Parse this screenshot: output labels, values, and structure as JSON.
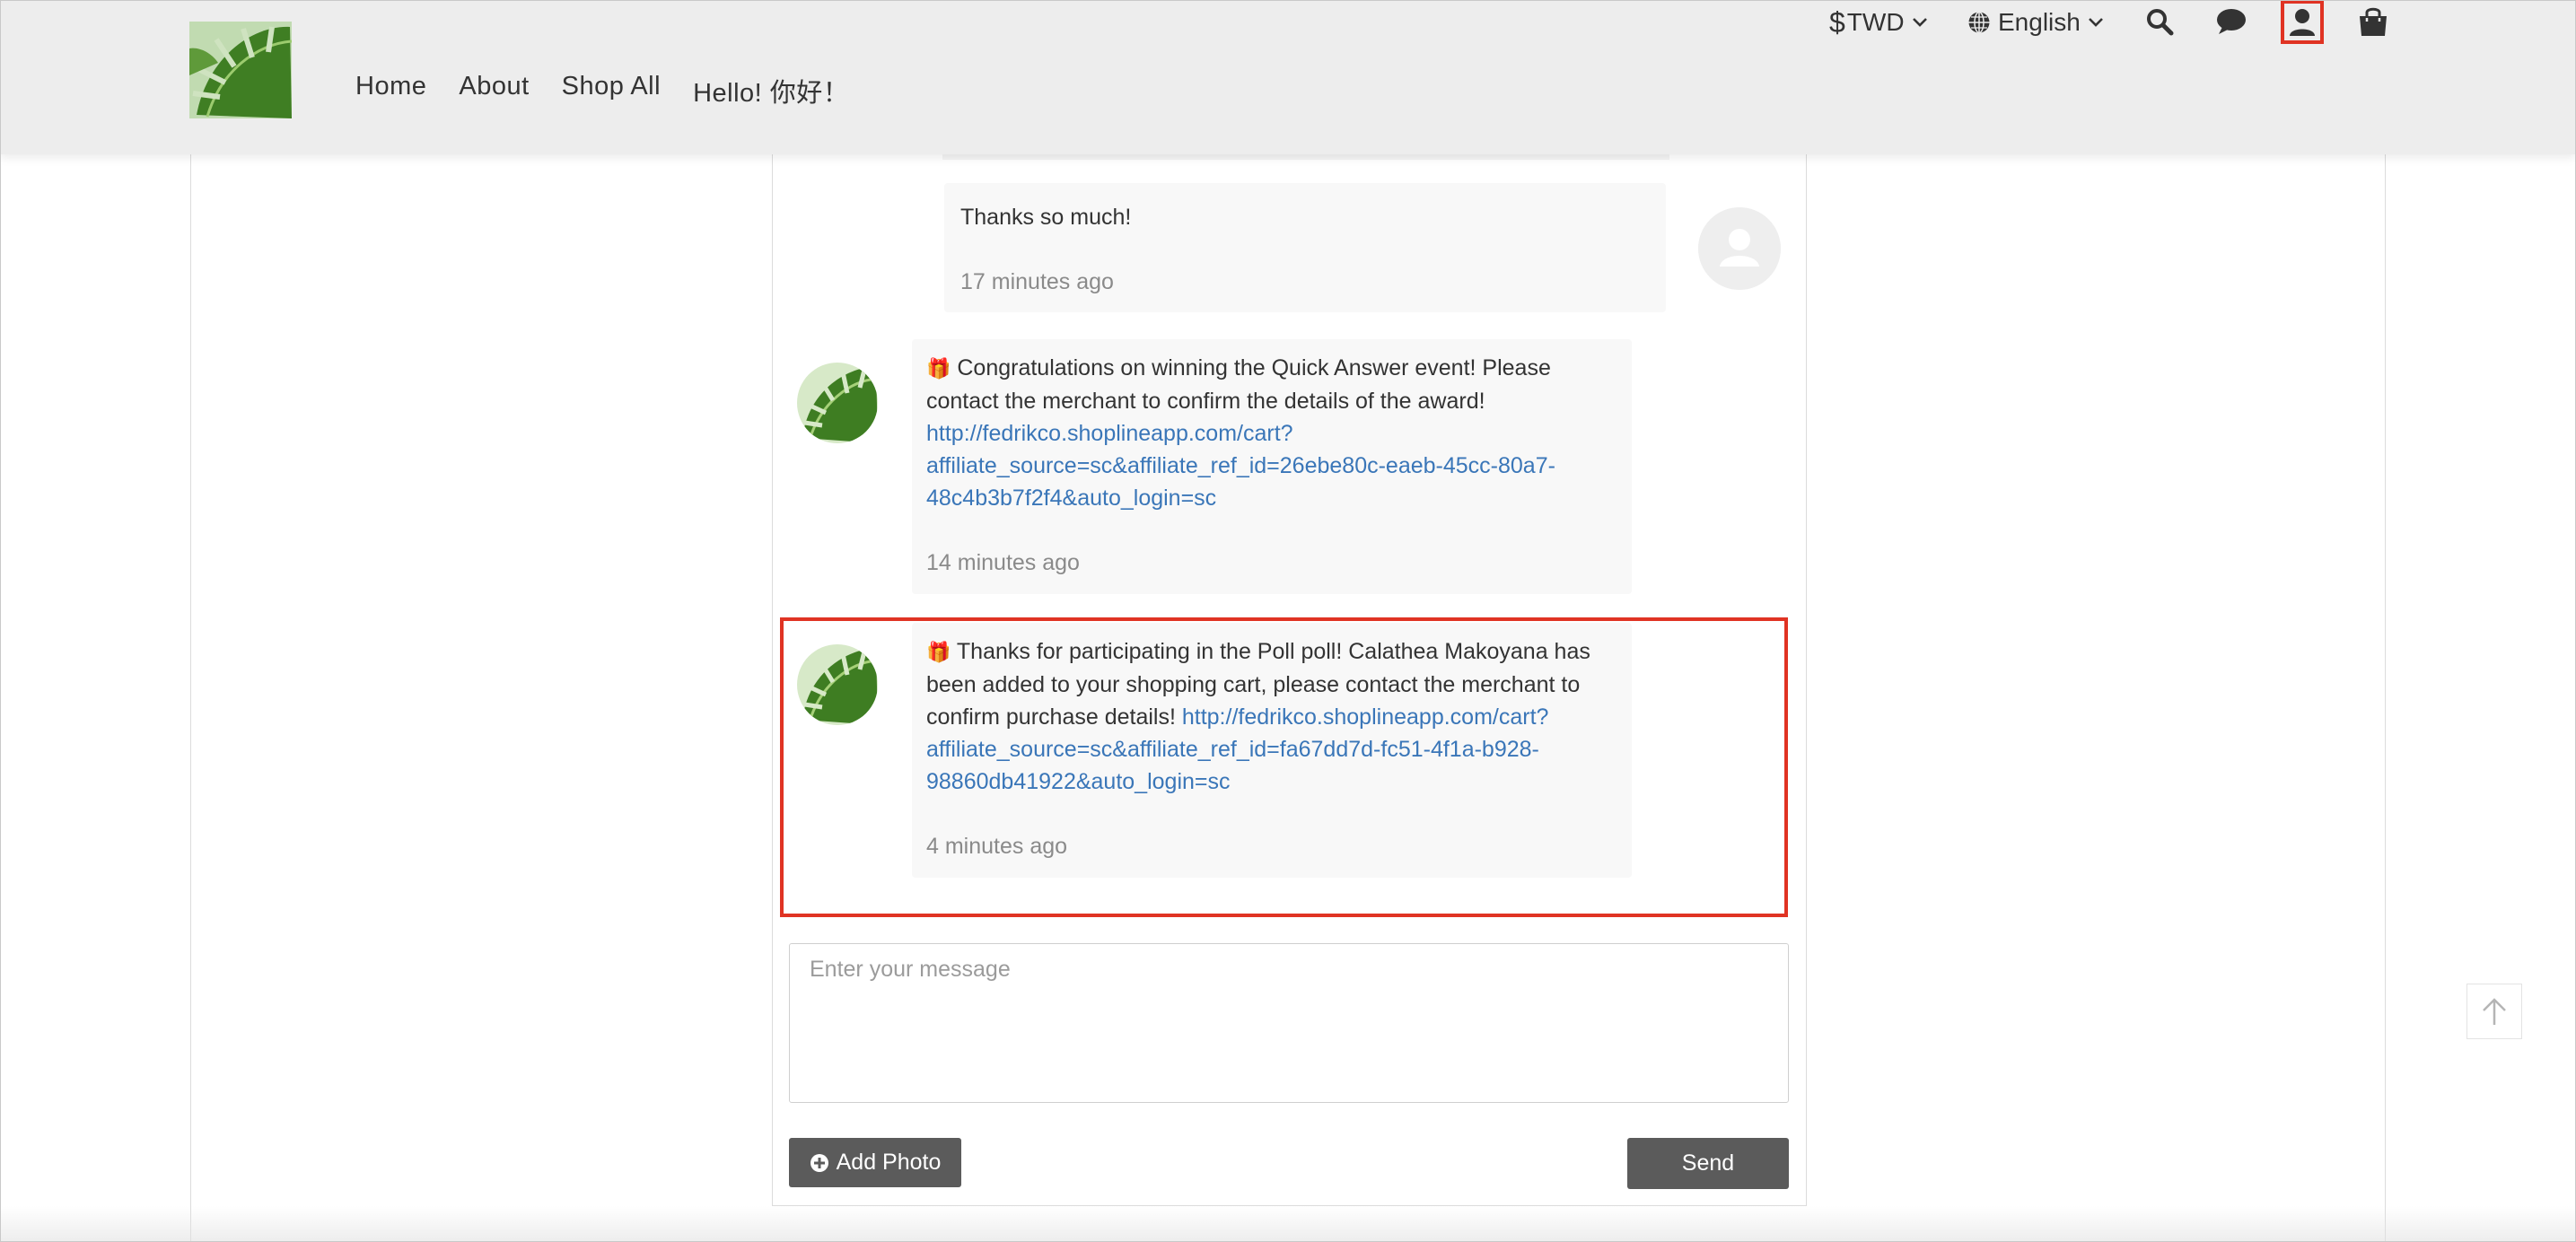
{
  "header": {
    "nav": [
      "Home",
      "About",
      "Shop All",
      "Hello! 你好！"
    ],
    "currency": "TWD",
    "currency_symbol": "$",
    "language": "English"
  },
  "messages": [
    {
      "sender": "user",
      "text": "Thanks so much!",
      "time": "17 minutes ago"
    },
    {
      "sender": "shop",
      "emoji": "🎁",
      "text": "Congratulations on winning the Quick Answer  event! Please contact the merchant to confirm the details of the award!",
      "link": "http://fedrikco.shoplineapp.com/cart?affiliate_source=sc&affiliate_ref_id=26ebe80c-eaeb-45cc-80a7-48c4b3b7f2f4&auto_login=sc",
      "link_line1": "http://fedrikco.shoplineapp.com/cart?",
      "link_line2": "affiliate_source=sc&affiliate_ref_id=26ebe80c-eaeb-45cc-80a7-",
      "link_line3": "48c4b3b7f2f4&auto_login=sc",
      "time": "14 minutes ago"
    },
    {
      "sender": "shop",
      "emoji": "🎁",
      "text": "Thanks for participating in the Poll poll! Calathea Makoyana has been added to your shopping cart, please contact the merchant to confirm purchase details!",
      "link_line1": "http://fedrikco.shoplineapp.com/cart?",
      "link_line2": "affiliate_source=sc&affiliate_ref_id=fa67dd7d-fc51-4f1a-b928-",
      "link_line3": "98860db41922&auto_login=sc",
      "time": "4 minutes ago"
    }
  ],
  "composer": {
    "placeholder": "Enter your message",
    "add_photo": "Add Photo",
    "send": "Send"
  },
  "colors": {
    "header_bg": "#ededed",
    "highlight": "#e03323",
    "link": "#3a76b8",
    "button_bg": "#5b5b5b"
  }
}
